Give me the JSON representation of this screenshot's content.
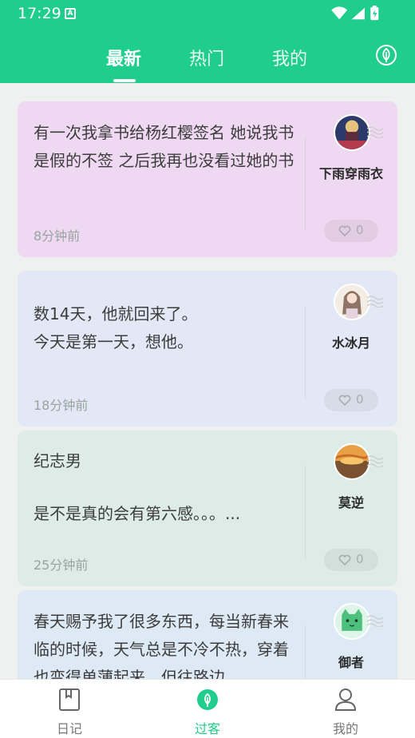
{
  "status": {
    "time": "17:29",
    "notification_glyph": "A"
  },
  "tabs": [
    {
      "label": "最新",
      "active": true
    },
    {
      "label": "热门",
      "active": false
    },
    {
      "label": "我的",
      "active": false
    }
  ],
  "colors": {
    "accent": "#1fcd8c"
  },
  "cards": [
    {
      "text": "有一次我拿书给杨红樱签名 她说我书是假的不签 之后我再也没看过她的书",
      "time": "8分钟前",
      "name": "下雨穿雨衣",
      "likes": "0",
      "bg": "#efd9f2"
    },
    {
      "text": "数14天，他就回来了。\n今天是第一天，想他。",
      "time": "18分钟前",
      "name": "水冰月",
      "likes": "0",
      "bg": "#e2e8f5"
    },
    {
      "text": "纪志男\n\n是不是真的会有第六感。。。...",
      "time": "25分钟前",
      "name": "莫逆",
      "likes": "0",
      "bg": "#ddece6"
    },
    {
      "text": "春天赐予我了很多东西，每当新春来临的时候，天气总是不冷不热，穿着也变得单薄起来，但往路边",
      "time": "",
      "name": "御者",
      "likes": "0",
      "bg": "#dde9f4"
    }
  ],
  "bottom_nav": [
    {
      "label": "日记",
      "icon": "diary-icon",
      "active": false
    },
    {
      "label": "过客",
      "icon": "leaf-icon",
      "active": true
    },
    {
      "label": "我的",
      "icon": "profile-icon",
      "active": false
    }
  ]
}
